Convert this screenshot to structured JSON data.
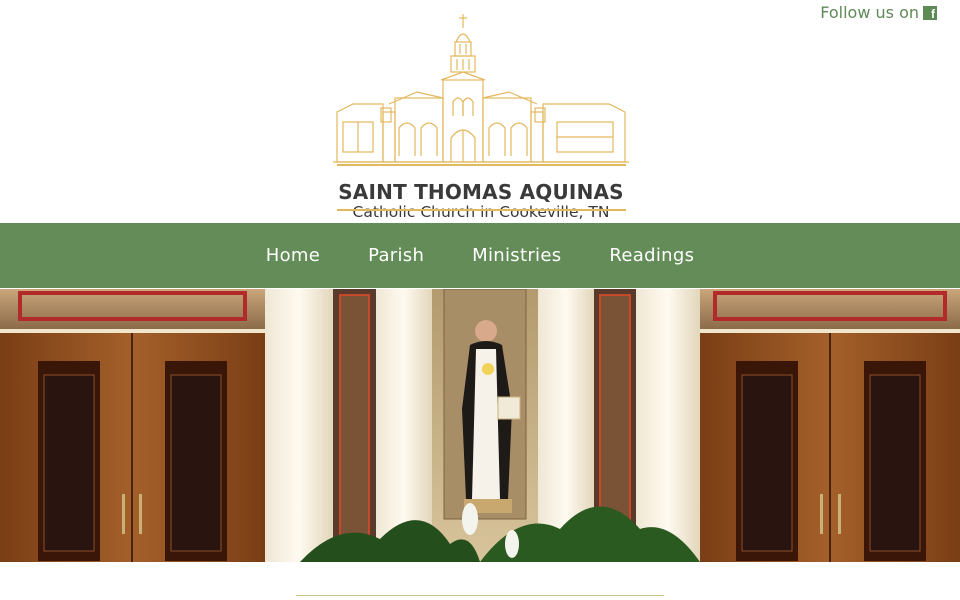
{
  "header": {
    "follow_text": "Follow us on",
    "facebook_icon": "facebook-icon",
    "logo_title": "SAINT THOMAS AQUINAS",
    "logo_subtitle": "Catholic Church in Cookeville, TN",
    "logo_icon": "church-building-icon"
  },
  "nav": {
    "items": [
      {
        "label": "Home"
      },
      {
        "label": "Parish"
      },
      {
        "label": "Ministries"
      },
      {
        "label": "Readings"
      }
    ]
  },
  "hero": {
    "image": "statue-of-saint-thomas-aquinas-in-church-sanctuary"
  },
  "colors": {
    "brand_green": "#648c58",
    "link_green": "#5e8a56",
    "logo_gold": "#e3b75d",
    "logo_text": "#3a3a3a"
  }
}
